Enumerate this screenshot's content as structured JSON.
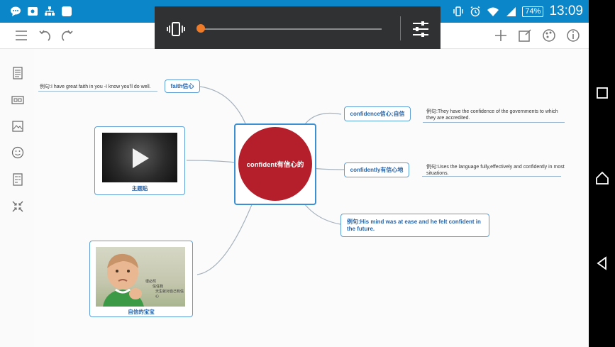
{
  "status_bar": {
    "battery": "74%",
    "time": "13:09",
    "icons": [
      "chat-bubble-icon",
      "message-icon",
      "network-icon",
      "app-icon",
      "vibrate-icon",
      "alarm-icon",
      "wifi-icon",
      "signal-icon"
    ]
  },
  "toolbar": {
    "left_icons": [
      "menu-icon",
      "undo-icon",
      "redo-icon"
    ],
    "right_icons": [
      "add-icon",
      "edit-icon",
      "palette-icon",
      "info-icon"
    ]
  },
  "media_overlay": {
    "progress": 0.0,
    "icons": [
      "vibrate-icon",
      "equalizer-icon"
    ]
  },
  "left_panel_icons": [
    "outline-icon",
    "link-icon",
    "image-icon",
    "emoji-icon",
    "notes-icon",
    "collapse-icon"
  ],
  "mind_map": {
    "center": "confident有信心的",
    "nodes": {
      "faith": "faith信心",
      "faith_note": "例句:I have great faith in you -I know you'll do well.",
      "confidence": "confidence信心;自信",
      "confidence_note": "例句:They have the confidence of the governments to which they are accredited.",
      "confidently": "confidently有信心地",
      "confidently_note": "例句:Uses the language fully,effectively and confidently in most situations.",
      "example": "例句:His mind was at ease and he felt confident in the future.",
      "video_caption": "主题贴",
      "photo_caption": "自信的宝宝",
      "photo_text_lines": [
        "很必然",
        "信任我",
        "天生就对自己有信心"
      ]
    }
  },
  "colors": {
    "status_bar": "#0a86c9",
    "center_fill": "#b51f2c",
    "node_border": "#5c9fd6",
    "node_text": "#2a65a8",
    "media_knob": "#ef7a27"
  },
  "nav_bar_icons": [
    "recent-apps-icon",
    "home-icon",
    "back-icon"
  ]
}
